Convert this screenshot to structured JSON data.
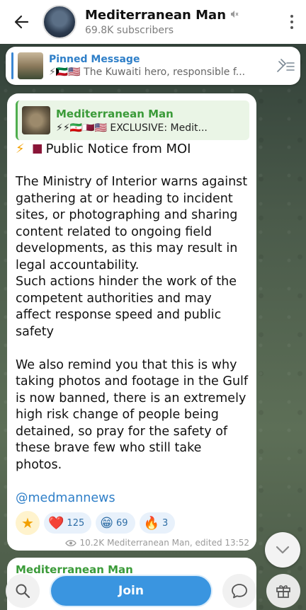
{
  "header": {
    "title": "Mediterranean Man",
    "subscribers": "69.8K subscribers"
  },
  "pinned": {
    "label": "Pinned Message",
    "snippet": "⚡🇰🇼🇺🇸 The Kuwaiti hero, responsible f..."
  },
  "message": {
    "reply_name": "Mediterranean Man",
    "reply_snippet": "⚡⚡🇮🇷🇶🇦🇺🇸 EXCLUSIVE: Medit...",
    "heading": "Public Notice from MOI",
    "paragraph1": "The Ministry of Interior warns against gathering at or heading to incident sites, or photographing and sharing content related to ongoing field developments, as this may result in legal accountability.",
    "paragraph1b": "Such actions hinder the work of the competent authorities and may affect response speed and public safety",
    "paragraph2": "We also remind you that this is why taking photos and footage in the Gulf is now banned, there is an extremely high risk change of people being detained, so pray for the safety of these brave few who still take photos.",
    "link": "@medmannews",
    "reactions": [
      {
        "emoji": "❤️",
        "count": "125"
      },
      {
        "emoji": "😁",
        "count": "69"
      },
      {
        "emoji": "🔥",
        "count": "3"
      }
    ],
    "views": "10.2K",
    "meta": "Mediterranean Man, edited 13:52"
  },
  "next_message": {
    "name": "Mediterranean Man"
  },
  "bottom": {
    "join_label": "Join"
  }
}
